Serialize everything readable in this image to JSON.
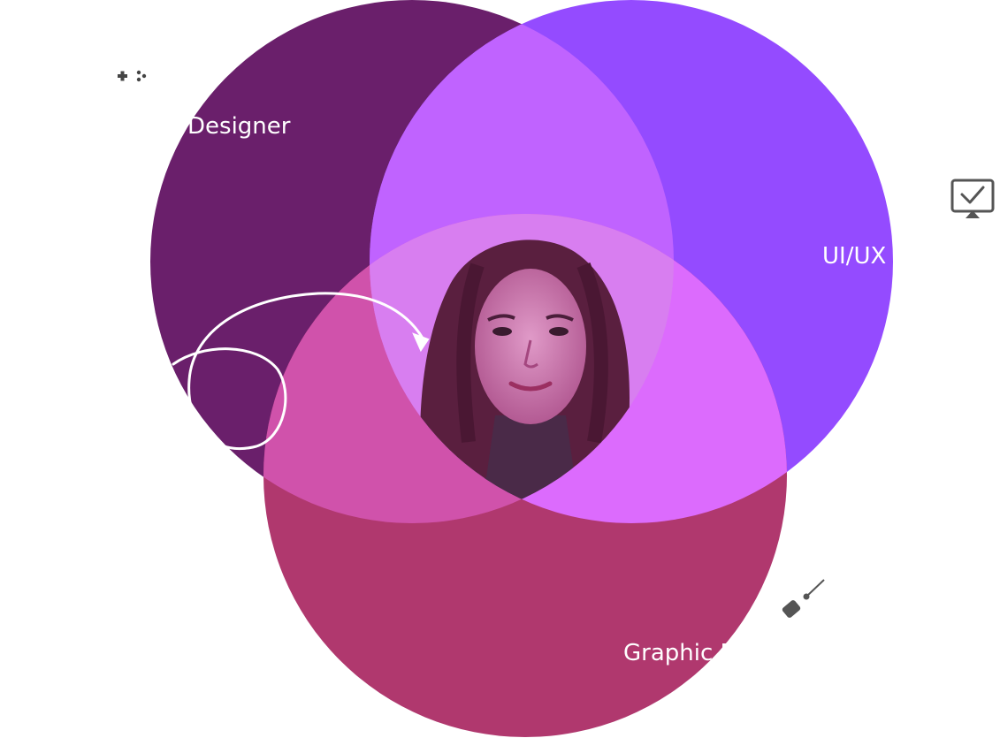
{
  "labels": {
    "designer": "Designer",
    "uiux": "UI/UX",
    "graphic": "Graphic D"
  },
  "colors": {
    "designer_circle": "#6a1f6b",
    "uiux_circle": "#944bff",
    "graphic_circle": "#b0386e",
    "designer_uiux_overlap": "#c063ff",
    "uiux_graphic_overlap": "#dc6bfd",
    "designer_graphic_overlap": "#d052ab",
    "center": "#d87ef0",
    "icon_gray": "#555555"
  },
  "icons": {
    "top_left": "plus-dots-icon",
    "right": "monitor-check-icon",
    "bottom": "paint-brush-icon",
    "doodle": "loop-arrow-doodle"
  }
}
